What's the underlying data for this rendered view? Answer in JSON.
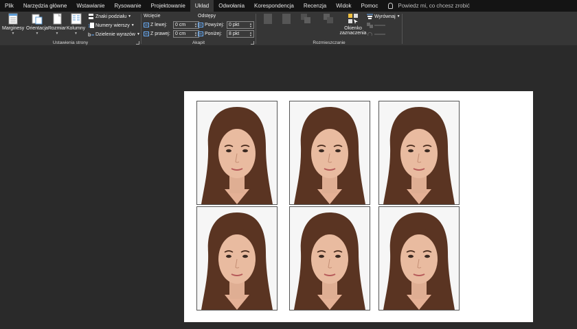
{
  "tabs": [
    {
      "label": "Plik",
      "active": false
    },
    {
      "label": "Narzędzia główne",
      "active": false
    },
    {
      "label": "Wstawianie",
      "active": false
    },
    {
      "label": "Rysowanie",
      "active": false
    },
    {
      "label": "Projektowanie",
      "active": false
    },
    {
      "label": "Układ",
      "active": true
    },
    {
      "label": "Odwołania",
      "active": false
    },
    {
      "label": "Korespondencja",
      "active": false
    },
    {
      "label": "Recenzja",
      "active": false
    },
    {
      "label": "Widok",
      "active": false
    },
    {
      "label": "Pomoc",
      "active": false
    }
  ],
  "tell_me": {
    "label": "Powiedz mi, co chcesz zrobić"
  },
  "page_setup": {
    "group_label": "Ustawienia strony",
    "margins": "Marginesy",
    "orientation": "Orientacja",
    "size": "Rozmiar",
    "columns": "Kolumny",
    "breaks": "Znaki podziału",
    "line_numbers": "Numery wierszy",
    "hyphenation": "Dzielenie wyrazów"
  },
  "paragraph": {
    "group_label": "Akapit",
    "indent_label": "Wcięcie",
    "spacing_label": "Odstępy",
    "left_label": "Z lewej:",
    "left_value": "0 cm",
    "right_label": "Z prawej:",
    "right_value": "0 cm",
    "before_label": "Powyżej:",
    "before_value": "0 pkt",
    "after_label": "Poniżej:",
    "after_value": "8 pkt"
  },
  "arrange": {
    "group_label": "Rozmieszczanie",
    "selection_pane_line1": "Okienko",
    "selection_pane_line2": "zaznaczenia",
    "align": "Wyrównaj"
  },
  "colors": {
    "tabbar_bg": "#141414",
    "ribbon_bg": "#363636",
    "canvas_bg": "#2a2a2a",
    "page_bg": "#ffffff",
    "accent_blue": "#6ab0ff"
  },
  "document": {
    "photo_count": 6
  }
}
